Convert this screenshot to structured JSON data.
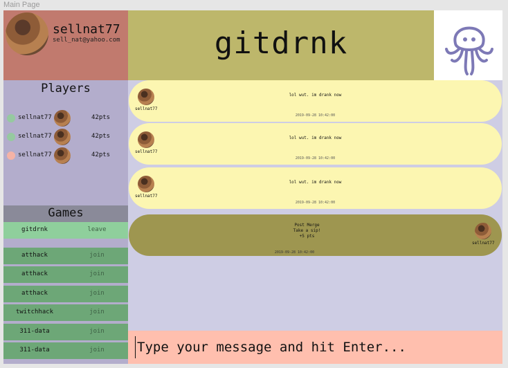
{
  "window": {
    "label": "Main Page"
  },
  "profile": {
    "username": "sellnat77",
    "email": "sell_nat@yahoo.com"
  },
  "header": {
    "title": "gitdrnk",
    "logo_icon": "octopus-icon"
  },
  "players": {
    "title": "Players",
    "items": [
      {
        "name": "sellnat77",
        "points": "42pts",
        "status_color": "#96c9a0"
      },
      {
        "name": "sellnat77",
        "points": "42pts",
        "status_color": "#96c9a0"
      },
      {
        "name": "sellnat77",
        "points": "42pts",
        "status_color": "#f5b3a6"
      }
    ]
  },
  "games": {
    "title": "Games",
    "items": [
      {
        "name": "gitdrnk",
        "action": "leave",
        "active": true
      },
      {
        "name": "atthack",
        "action": "join"
      },
      {
        "name": "atthack",
        "action": "join"
      },
      {
        "name": "atthack",
        "action": "join"
      },
      {
        "name": "twitchhack",
        "action": "join"
      },
      {
        "name": "311-data",
        "action": "join"
      },
      {
        "name": "311-data",
        "action": "join"
      }
    ]
  },
  "messages": [
    {
      "user": "sellnat77",
      "text": "lol wut. im drank now",
      "time": "2019-09-28 10:42:00"
    },
    {
      "user": "sellnat77",
      "text": "lol wut. im drank now",
      "time": "2019-09-28 10:42:00"
    },
    {
      "user": "sellnat77",
      "text": "lol wut. im drank now",
      "time": "2019-09-28 10:42:00"
    }
  ],
  "event": {
    "line1": "Post Merge",
    "line2": "Take a sip!",
    "line3": "+5 pts",
    "user": "sellnat77",
    "time": "2019-09-28 10:42:00"
  },
  "composer": {
    "placeholder": "Type your message and hit Enter..."
  }
}
